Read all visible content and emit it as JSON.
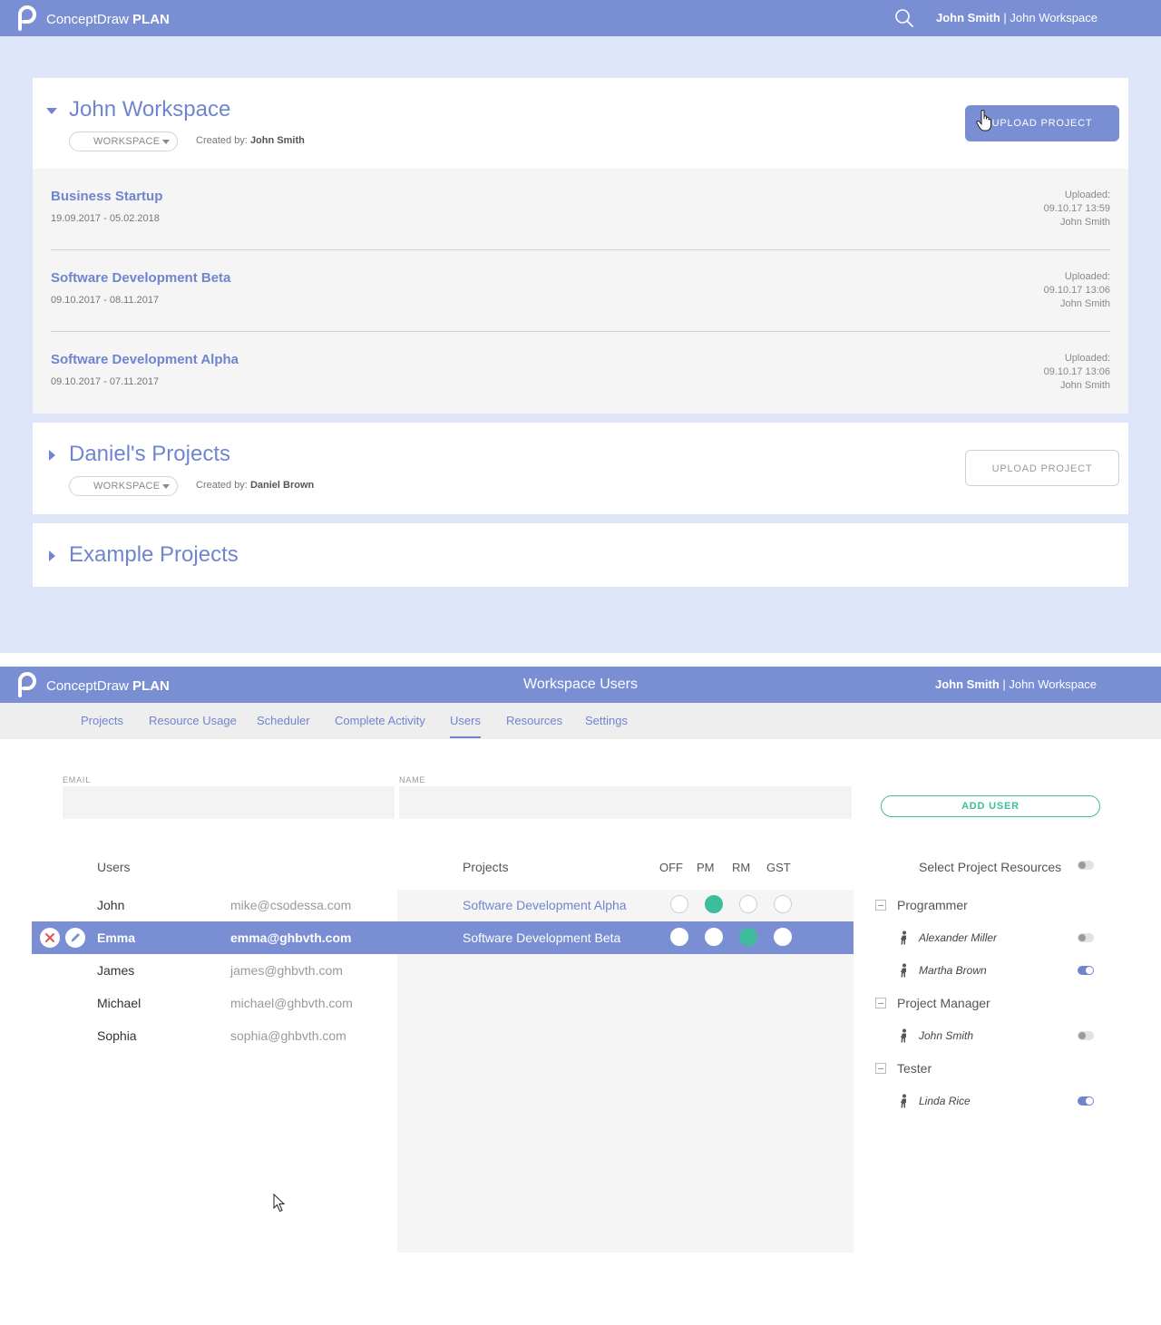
{
  "brand": {
    "name": "ConceptDraw",
    "product": "PLAN"
  },
  "user": {
    "name": "John Smith",
    "separator": "|",
    "workspace": "John Workspace"
  },
  "screen1": {
    "workspaces": [
      {
        "title": "John Workspace",
        "expanded": true,
        "type_label": "WORKSPACE",
        "created_by_label": "Created by:",
        "created_by": "John Smith",
        "upload_label": "UPLOAD PROJECT",
        "projects": [
          {
            "name": "Business Startup",
            "dates": "19.09.2017 - 05.02.2018",
            "uploaded_label": "Uploaded:",
            "uploaded_at": "09.10.17 13:59",
            "uploaded_by": "John Smith"
          },
          {
            "name": "Software Development Beta",
            "dates": "09.10.2017 - 08.11.2017",
            "uploaded_label": "Uploaded:",
            "uploaded_at": "09.10.17 13:06",
            "uploaded_by": "John Smith"
          },
          {
            "name": "Software Development Alpha",
            "dates": "09.10.2017 - 07.11.2017",
            "uploaded_label": "Uploaded:",
            "uploaded_at": "09.10.17 13:06",
            "uploaded_by": "John Smith"
          }
        ]
      },
      {
        "title": "Daniel's Projects",
        "expanded": false,
        "type_label": "WORKSPACE",
        "created_by_label": "Created by:",
        "created_by": "Daniel Brown",
        "upload_label": "UPLOAD PROJECT"
      },
      {
        "title": "Example Projects",
        "expanded": false
      }
    ]
  },
  "screen2": {
    "page_title": "Workspace Users",
    "tabs": [
      "Projects",
      "Resource Usage",
      "Scheduler",
      "Complete Activity",
      "Users",
      "Resources",
      "Settings"
    ],
    "active_tab": "Users",
    "form": {
      "email_label": "EMAIL",
      "name_label": "NAME",
      "email_value": "",
      "name_value": "",
      "add_button": "ADD USER"
    },
    "columns": {
      "users": "Users",
      "projects": "Projects",
      "roles": [
        "OFF",
        "PM",
        "RM",
        "GST"
      ]
    },
    "users": [
      {
        "name": "John",
        "email": "mike@csodessa.com",
        "project": "Software Development Alpha",
        "role": "PM",
        "selected": false
      },
      {
        "name": "Emma",
        "email": "emma@ghbvth.com",
        "project": "Software Development Beta",
        "role": "RM",
        "selected": true
      },
      {
        "name": "James",
        "email": "james@ghbvth.com"
      },
      {
        "name": "Michael",
        "email": "michael@ghbvth.com"
      },
      {
        "name": "Sophia",
        "email": "sophia@ghbvth.com"
      }
    ],
    "resources": {
      "title": "Select Project Resources",
      "all_on": false,
      "groups": [
        {
          "name": "Programmer",
          "members": [
            {
              "name": "Alexander Miller",
              "on": false
            },
            {
              "name": "Martha Brown",
              "on": true
            }
          ]
        },
        {
          "name": "Project Manager",
          "members": [
            {
              "name": "John Smith",
              "on": false
            }
          ]
        },
        {
          "name": "Tester",
          "members": [
            {
              "name": "Linda Rice",
              "on": true
            }
          ]
        }
      ]
    },
    "colors": {
      "accent": "#7a8fd3",
      "green": "#3dbd9b",
      "delete": "#e05555"
    }
  }
}
